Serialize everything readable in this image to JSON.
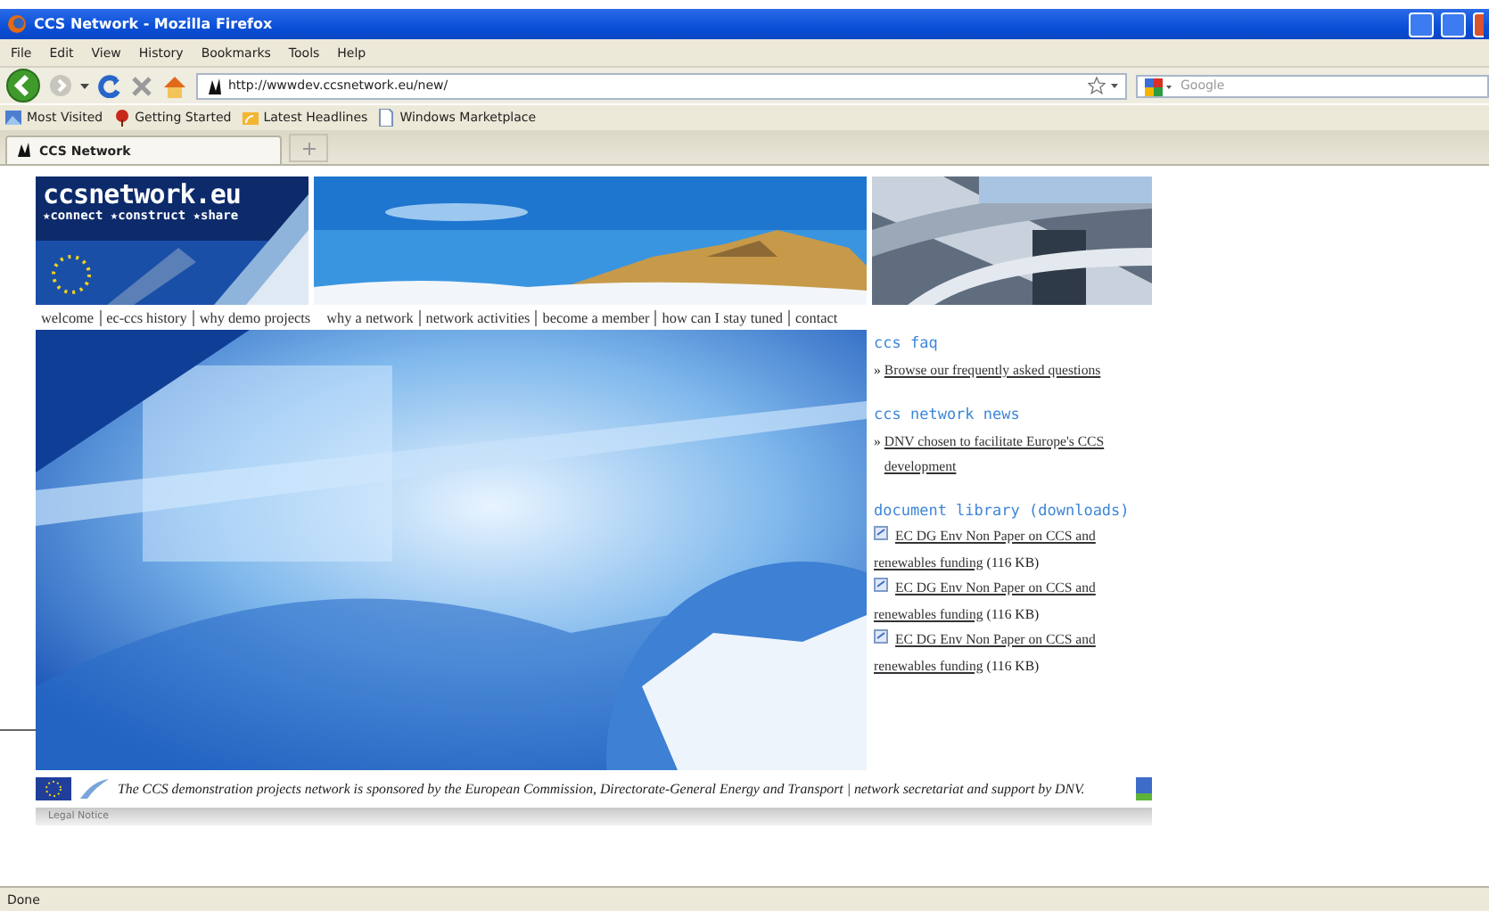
{
  "window": {
    "title": "CCS Network - Mozilla Firefox"
  },
  "menu": [
    "File",
    "Edit",
    "View",
    "History",
    "Bookmarks",
    "Tools",
    "Help"
  ],
  "address": {
    "value": "http://wwwdev.ccsnetwork.eu/new/"
  },
  "search": {
    "placeholder": "Google"
  },
  "bookmarks": [
    {
      "label": "Most Visited",
      "kind": "site"
    },
    {
      "label": "Getting Started",
      "kind": "flower"
    },
    {
      "label": "Latest Headlines",
      "kind": "feed"
    },
    {
      "label": "Windows Marketplace",
      "kind": "page"
    }
  ],
  "tabs": [
    {
      "label": "CCS Network",
      "selected": true
    }
  ],
  "logo": {
    "name": "ccsnetwork.eu",
    "tagline": "★connect ★construct ★share"
  },
  "nav": [
    [
      "welcome",
      "ec-ccs history",
      "why demo projects"
    ],
    [
      "why a network",
      "network activities",
      "become a member",
      "how can I stay tuned",
      "contact"
    ]
  ],
  "sections": [
    {
      "heading": "ccs faq",
      "links": [
        {
          "bullet": "»",
          "text": "Browse our frequently asked questions"
        }
      ]
    },
    {
      "heading": "ccs network news",
      "links": [
        {
          "bullet": "»",
          "text": "DNV chosen to facilitate Europe's CCS development"
        }
      ]
    }
  ],
  "library": {
    "heading": "document library (downloads)",
    "documents": [
      {
        "title": "EC DG Env Non Paper on CCS and renewables funding",
        "size": "(116 KB)"
      },
      {
        "title": "EC DG Env Non Paper on CCS and renewables funding",
        "size": "(116 KB)"
      },
      {
        "title": "EC DG Env Non Paper on CCS and renewables funding",
        "size": "(116 KB)"
      }
    ]
  },
  "footer": {
    "text": "The CCS demonstration projects network is sponsored by the European Commission, Directorate-General Energy and Transport | network secretariat and support by DNV.",
    "legal": "Legal Notice"
  },
  "status_bar": "Done"
}
